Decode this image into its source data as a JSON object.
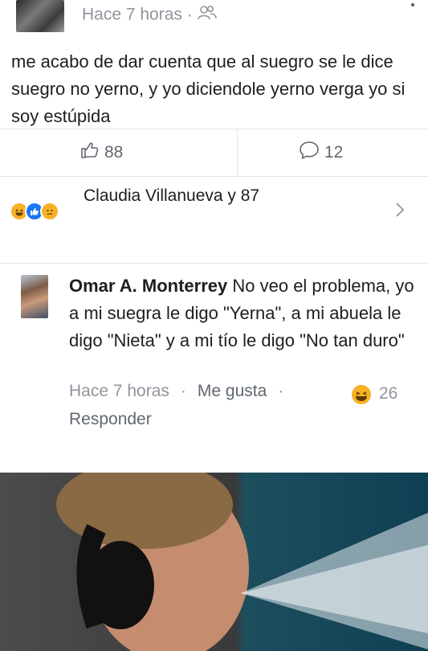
{
  "post": {
    "timestamp": "Hace 7 horas",
    "separator": "·",
    "audience_icon": "friends-icon",
    "text": "me acabo de dar cuenta que al suegro se le dice suegro no yerno, y yo diciendole yerno verga yo si soy estúpida"
  },
  "actions": {
    "like_icon": "thumbs-up-icon",
    "like_count": "88",
    "comment_icon": "comment-bubble-icon",
    "comment_count": "12"
  },
  "reactions": {
    "icons": [
      "haha-reaction-icon",
      "like-reaction-icon",
      "sad-reaction-icon"
    ],
    "summary": "Claudia Villanueva y 87"
  },
  "comment": {
    "author": "Omar A. Monterrey",
    "text": "No veo el problema, yo a mi suegra le digo \"Yerna\", a mi abuela le digo \"Nieta\" y a mi tío le digo \"No tan duro\"",
    "time": "Hace 7 horas",
    "separator": "·",
    "like_label": "Me gusta",
    "reaction_count": "26",
    "reply_label": "Responder"
  },
  "colors": {
    "text": "#1c1e21",
    "meta": "#90949c",
    "link": "#606770",
    "divider": "#e5e6e9",
    "like_blue": "#1877f2",
    "haha_yellow": "#f7b125"
  }
}
